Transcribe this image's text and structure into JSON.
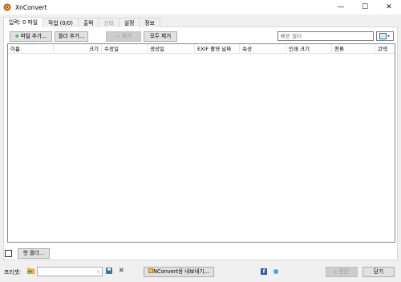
{
  "window": {
    "title": "XnConvert",
    "minimize": "—",
    "maximize": "☐",
    "close": "✕"
  },
  "tabs": [
    {
      "label": "입력: 0 파일",
      "state": "active"
    },
    {
      "label": "작업 (0/0)",
      "state": "normal"
    },
    {
      "label": "출력",
      "state": "normal"
    },
    {
      "label": "상태",
      "state": "disabled"
    },
    {
      "label": "설정",
      "state": "normal"
    },
    {
      "label": "정보",
      "state": "normal"
    }
  ],
  "toolbar": {
    "add_files": "파일 추가...",
    "add_folder": "폴더 추가...",
    "remove": "제거",
    "remove_all": "모두 제거",
    "filter_placeholder": "빠른 필터"
  },
  "file_list": {
    "columns": [
      "이름",
      "크기",
      "수정일",
      "생성일",
      "EXIF 촬영 날짜",
      "속성",
      "인쇄 크기",
      "종류",
      "코덱"
    ],
    "rows": []
  },
  "hot_folder": {
    "checked": false,
    "button_label": "핫 폴더..."
  },
  "bottom_bar": {
    "preset_label": "프리셋:",
    "preset_value": "",
    "export_label": "NConvert용 내보내기...",
    "convert_label": "변환",
    "close_label": "닫기"
  },
  "colors": {
    "accent_green": "#2e9e3e",
    "folder_yellow": "#e8b64a",
    "facebook_blue": "#3b5998"
  }
}
